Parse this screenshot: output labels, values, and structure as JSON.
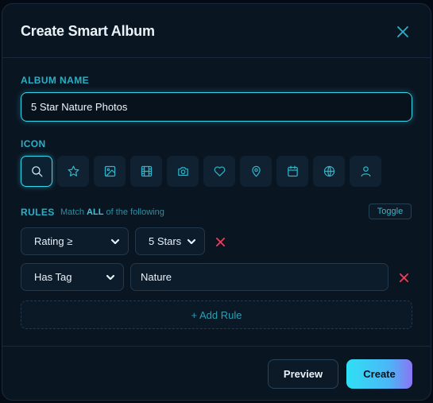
{
  "dialog": {
    "title": "Create Smart Album",
    "close_icon": "close-icon"
  },
  "album_name": {
    "label": "ALBUM NAME",
    "value": "5 Star Nature Photos"
  },
  "icon_picker": {
    "label": "ICON",
    "selected": "search-icon",
    "icons": [
      "search-icon",
      "star-icon",
      "image-icon",
      "film-icon",
      "camera-icon",
      "heart-icon",
      "map-pin-icon",
      "calendar-icon",
      "globe-icon",
      "user-icon"
    ]
  },
  "rules": {
    "label": "RULES",
    "match_prefix": "Match",
    "match_mode": "ALL",
    "match_suffix": "of the following",
    "toggle_label": "Toggle",
    "items": [
      {
        "field": "Rating ≥",
        "value": "5 Stars"
      },
      {
        "field": "Has Tag",
        "value": "Nature"
      }
    ],
    "add_rule_label": "+ Add Rule"
  },
  "footer": {
    "preview_label": "Preview",
    "create_label": "Create"
  },
  "colors": {
    "accent": "#33d6ec",
    "danger": "#e0405d",
    "background": "#0a1522"
  }
}
